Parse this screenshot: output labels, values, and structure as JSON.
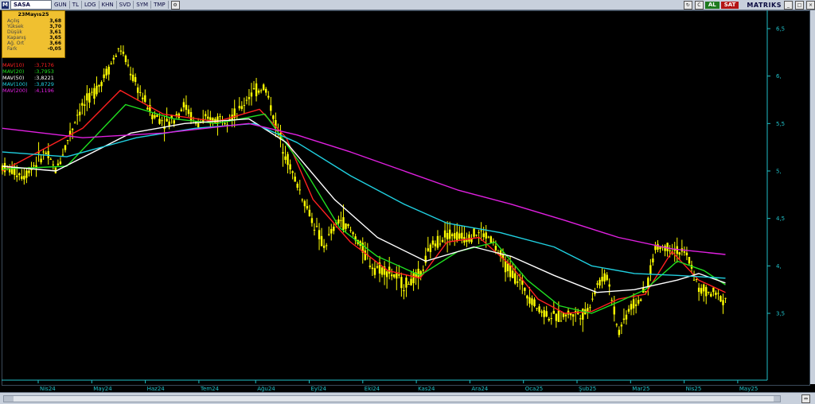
{
  "toolbar": {
    "logo": "M",
    "symbol": "SASA",
    "items": [
      "GUN",
      "TL",
      "LOG",
      "KHN",
      "SVD",
      "SYM",
      "TMP"
    ],
    "buy_label": "AL",
    "sell_label": "SAT",
    "brand": "MATRIKS"
  },
  "info_box": {
    "date": "23Mayıs25",
    "rows": [
      {
        "label": "Açılış",
        "value": "3,68"
      },
      {
        "label": "Yüksek",
        "value": "3,70"
      },
      {
        "label": "Düşük",
        "value": "3,61"
      },
      {
        "label": "Kapanış",
        "value": "3,65"
      },
      {
        "label": "Ağ. Ort",
        "value": "3,66"
      },
      {
        "label": "Fark",
        "value": "-0,05"
      }
    ]
  },
  "moving_averages": [
    {
      "name": "MAV(10)",
      "value": ":3,7176",
      "color": "#ff2020"
    },
    {
      "name": "MAV(20)",
      "value": ":3,7953",
      "color": "#20e020"
    },
    {
      "name": "MAV(50)",
      "value": ":3,8221",
      "color": "#ffffff"
    },
    {
      "name": "MAV(100)",
      "value": ":3,8729",
      "color": "#20d0e0"
    },
    {
      "name": "MAV(200)",
      "value": ":4,1196",
      "color": "#e020e0"
    }
  ],
  "colors": {
    "candle": "#ffff00",
    "axis": "#20c0c8",
    "background": "#000000"
  },
  "chart_data": {
    "type": "line",
    "y_axis_ticks": [
      "6,5",
      "6,",
      "5,5",
      "5,",
      "4,5",
      "4,",
      "3,5"
    ],
    "ylim": [
      3.0,
      6.7
    ],
    "x_tick_labels": [
      "Nis24",
      "May24",
      "Haz24",
      "Tem24",
      "Ağu24",
      "Eyl24",
      "Eki24",
      "Kas24",
      "Ara24",
      "Oca25",
      "Şub25",
      "Mar25",
      "Nis25",
      "May25"
    ],
    "price_path": [
      [
        0,
        5.05
      ],
      [
        0.4,
        4.95
      ],
      [
        0.8,
        5.2
      ],
      [
        1.0,
        5.0
      ],
      [
        1.4,
        5.6
      ],
      [
        1.8,
        5.9
      ],
      [
        2.2,
        6.3
      ],
      [
        2.5,
        5.9
      ],
      [
        2.8,
        5.6
      ],
      [
        3.1,
        5.5
      ],
      [
        3.4,
        5.7
      ],
      [
        3.6,
        5.5
      ],
      [
        4.0,
        5.55
      ],
      [
        4.4,
        5.6
      ],
      [
        4.6,
        5.8
      ],
      [
        4.9,
        5.9
      ],
      [
        5.1,
        5.5
      ],
      [
        5.4,
        5.0
      ],
      [
        5.7,
        4.6
      ],
      [
        6.0,
        4.2
      ],
      [
        6.3,
        4.5
      ],
      [
        6.6,
        4.3
      ],
      [
        6.9,
        4.0
      ],
      [
        7.2,
        3.95
      ],
      [
        7.5,
        3.8
      ],
      [
        7.8,
        3.9
      ],
      [
        8.0,
        4.2
      ],
      [
        8.3,
        4.35
      ],
      [
        8.6,
        4.3
      ],
      [
        8.9,
        4.35
      ],
      [
        9.1,
        4.3
      ],
      [
        9.4,
        4.0
      ],
      [
        9.7,
        3.8
      ],
      [
        10.0,
        3.55
      ],
      [
        10.3,
        3.45
      ],
      [
        10.6,
        3.5
      ],
      [
        10.9,
        3.5
      ],
      [
        11.1,
        3.8
      ],
      [
        11.3,
        3.9
      ],
      [
        11.5,
        3.3
      ],
      [
        11.7,
        3.55
      ],
      [
        12.0,
        3.7
      ],
      [
        12.2,
        4.2
      ],
      [
        12.5,
        4.2
      ],
      [
        12.8,
        4.1
      ],
      [
        13.0,
        3.75
      ],
      [
        13.3,
        3.7
      ],
      [
        13.5,
        3.65
      ]
    ],
    "series": [
      {
        "name": "MAV(10)",
        "values": [
          [
            0,
            5.0
          ],
          [
            1.5,
            5.45
          ],
          [
            2.2,
            5.85
          ],
          [
            3.0,
            5.6
          ],
          [
            4.0,
            5.52
          ],
          [
            4.8,
            5.65
          ],
          [
            5.3,
            5.35
          ],
          [
            5.8,
            4.7
          ],
          [
            6.5,
            4.25
          ],
          [
            7.2,
            3.95
          ],
          [
            7.8,
            3.87
          ],
          [
            8.3,
            4.25
          ],
          [
            8.9,
            4.3
          ],
          [
            9.5,
            4.0
          ],
          [
            10.0,
            3.65
          ],
          [
            10.5,
            3.5
          ],
          [
            11.0,
            3.52
          ],
          [
            11.5,
            3.65
          ],
          [
            12.0,
            3.7
          ],
          [
            12.5,
            4.15
          ],
          [
            13.0,
            3.85
          ],
          [
            13.5,
            3.72
          ]
        ]
      },
      {
        "name": "MAV(20)",
        "values": [
          [
            0,
            5.02
          ],
          [
            1.2,
            5.05
          ],
          [
            2.3,
            5.7
          ],
          [
            3.2,
            5.55
          ],
          [
            4.0,
            5.5
          ],
          [
            4.9,
            5.6
          ],
          [
            5.6,
            5.05
          ],
          [
            6.3,
            4.4
          ],
          [
            7.0,
            4.1
          ],
          [
            7.8,
            3.9
          ],
          [
            8.5,
            4.15
          ],
          [
            9.2,
            4.25
          ],
          [
            9.8,
            3.85
          ],
          [
            10.4,
            3.58
          ],
          [
            11.0,
            3.5
          ],
          [
            11.5,
            3.62
          ],
          [
            12.0,
            3.75
          ],
          [
            12.6,
            4.05
          ],
          [
            13.1,
            3.95
          ],
          [
            13.5,
            3.8
          ]
        ]
      },
      {
        "name": "MAV(50)",
        "values": [
          [
            0,
            5.05
          ],
          [
            1.0,
            5.0
          ],
          [
            2.4,
            5.4
          ],
          [
            3.4,
            5.5
          ],
          [
            4.6,
            5.55
          ],
          [
            5.3,
            5.3
          ],
          [
            6.2,
            4.7
          ],
          [
            7.0,
            4.3
          ],
          [
            7.9,
            4.05
          ],
          [
            8.8,
            4.2
          ],
          [
            9.5,
            4.1
          ],
          [
            10.3,
            3.9
          ],
          [
            11.1,
            3.72
          ],
          [
            11.8,
            3.75
          ],
          [
            12.6,
            3.85
          ],
          [
            13.0,
            3.92
          ],
          [
            13.5,
            3.82
          ]
        ]
      },
      {
        "name": "MAV(100)",
        "values": [
          [
            0,
            5.2
          ],
          [
            1.2,
            5.15
          ],
          [
            2.5,
            5.35
          ],
          [
            3.6,
            5.45
          ],
          [
            4.7,
            5.5
          ],
          [
            5.5,
            5.3
          ],
          [
            6.5,
            4.95
          ],
          [
            7.5,
            4.65
          ],
          [
            8.3,
            4.45
          ],
          [
            9.3,
            4.35
          ],
          [
            10.3,
            4.2
          ],
          [
            11.0,
            4.0
          ],
          [
            11.8,
            3.92
          ],
          [
            12.6,
            3.9
          ],
          [
            13.5,
            3.87
          ]
        ]
      },
      {
        "name": "MAV(200)",
        "values": [
          [
            0,
            5.45
          ],
          [
            1.5,
            5.35
          ],
          [
            3.0,
            5.4
          ],
          [
            4.6,
            5.5
          ],
          [
            5.5,
            5.38
          ],
          [
            6.5,
            5.2
          ],
          [
            7.5,
            5.0
          ],
          [
            8.5,
            4.8
          ],
          [
            9.5,
            4.65
          ],
          [
            10.5,
            4.48
          ],
          [
            11.5,
            4.3
          ],
          [
            12.5,
            4.18
          ],
          [
            13.5,
            4.12
          ]
        ]
      }
    ]
  }
}
